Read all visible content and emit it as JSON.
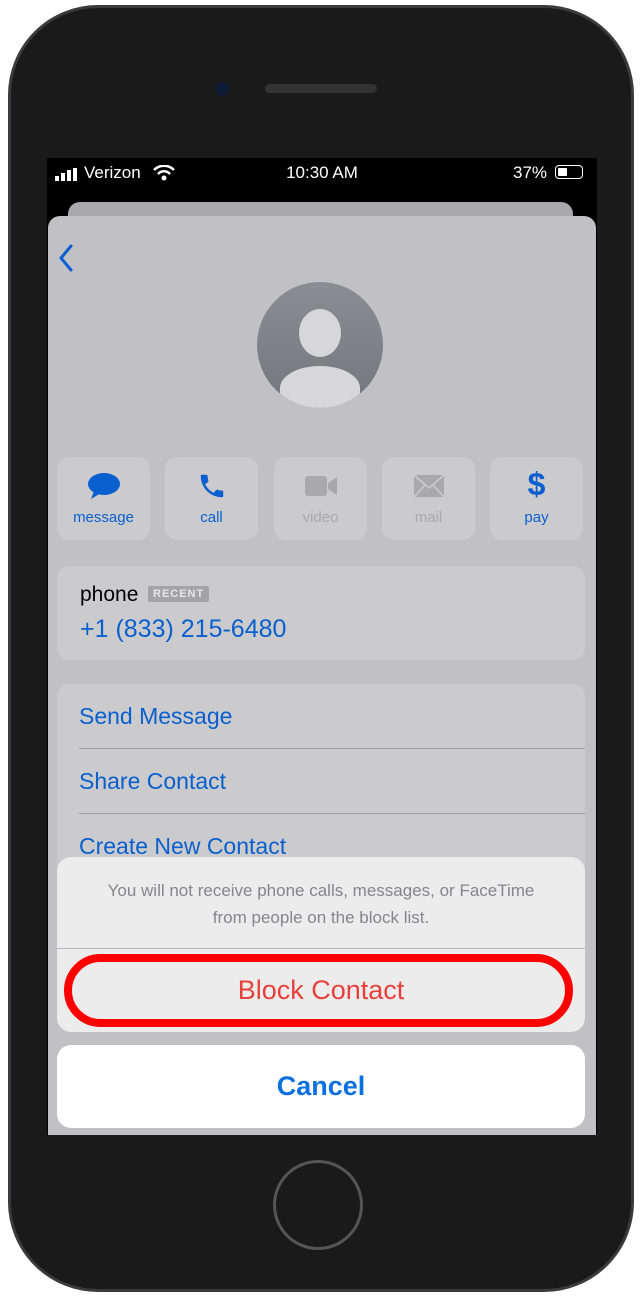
{
  "status_bar": {
    "carrier": "Verizon",
    "time": "10:30 AM",
    "battery": "37%",
    "battery_level": 0.37
  },
  "contact": {
    "actions": [
      {
        "label": "message",
        "icon": "message-bubble-icon",
        "enabled": true
      },
      {
        "label": "call",
        "icon": "phone-icon",
        "enabled": true
      },
      {
        "label": "video",
        "icon": "video-camera-icon",
        "enabled": false
      },
      {
        "label": "mail",
        "icon": "envelope-icon",
        "enabled": false
      },
      {
        "label": "pay",
        "icon": "dollar-icon",
        "enabled": true
      }
    ],
    "phone_label": "phone",
    "phone_badge": "RECENT",
    "phone_number": "+1 (833) 215-6480",
    "options": [
      "Send Message",
      "Share Contact",
      "Create New Contact"
    ]
  },
  "action_sheet": {
    "message": "You will not receive phone calls, messages, or FaceTime from people on the block list.",
    "block_label": "Block Contact",
    "cancel_label": "Cancel"
  },
  "colors": {
    "accent": "#0a5fcf",
    "destructive": "#e8403a",
    "highlight": "#ff0000"
  }
}
